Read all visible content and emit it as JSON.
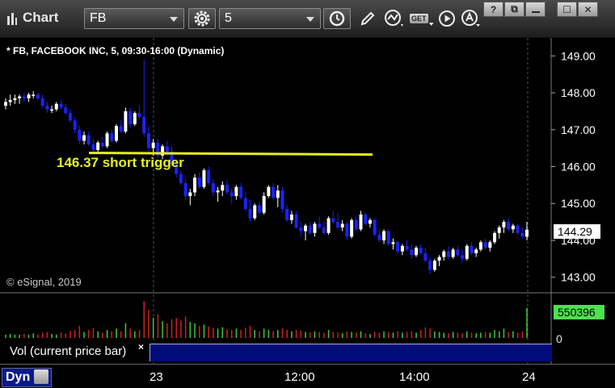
{
  "toolbar": {
    "title": "Chart",
    "symbol": "FB",
    "interval": "5",
    "get_label": "GET",
    "win_help": "?",
    "win_restore": "⧉",
    "win_max": "☐",
    "win_close": "✕"
  },
  "chart_header": "* FB, FACEBOOK INC, 5, 09:30-16:00 (Dynamic)",
  "annotation": "146.37 short trigger",
  "copyright": "© eSignal, 2019",
  "price_tag": "144.29",
  "volume_tag": "550396",
  "volume_zero": "0",
  "volume_label": "Vol (current price bar)",
  "volume_close": "×",
  "dyn_label": "Dyn",
  "x_ticks": [
    "23",
    "12:00",
    "14:00",
    "24"
  ],
  "colors": {
    "up": "#ffffff",
    "down": "#1a22ff",
    "trigger": "#e6f020",
    "vol_up": "#3cc83c",
    "vol_down": "#d02020"
  },
  "chart_data": [
    {
      "type": "candlestick",
      "title": "* FB, FACEBOOK INC, 5, 09:30-16:00 (Dynamic)",
      "ylim": [
        142.6,
        149.4
      ],
      "y_ticks": [
        149.0,
        148.0,
        147.0,
        146.0,
        145.0,
        144.0,
        143.0
      ],
      "grid": false,
      "horizontal_line": {
        "value": 146.37,
        "label": "146.37 short trigger"
      },
      "last_price": 144.29,
      "series": [
        {
          "values": [
            [
              147.65,
              147.85,
              147.55,
              147.75
            ],
            [
              147.75,
              147.95,
              147.65,
              147.8
            ],
            [
              147.8,
              147.95,
              147.7,
              147.85
            ],
            [
              147.85,
              147.95,
              147.7,
              147.9
            ],
            [
              147.9,
              148.0,
              147.75,
              147.85
            ],
            [
              147.85,
              148.0,
              147.75,
              147.95
            ],
            [
              147.95,
              148.05,
              147.85,
              147.95
            ],
            [
              147.95,
              148.0,
              147.8,
              147.85
            ],
            [
              147.85,
              147.95,
              147.6,
              147.65
            ],
            [
              147.65,
              147.75,
              147.45,
              147.55
            ],
            [
              147.55,
              147.65,
              147.45,
              147.55
            ],
            [
              147.55,
              147.75,
              147.5,
              147.7
            ],
            [
              147.7,
              147.8,
              147.55,
              147.6
            ],
            [
              147.6,
              147.7,
              147.4,
              147.45
            ],
            [
              147.45,
              147.55,
              147.2,
              147.25
            ],
            [
              147.25,
              147.35,
              146.9,
              147.0
            ],
            [
              147.0,
              147.1,
              146.6,
              146.7
            ],
            [
              146.7,
              146.95,
              146.6,
              146.85
            ],
            [
              146.85,
              146.95,
              146.55,
              146.6
            ],
            [
              146.6,
              146.75,
              146.35,
              146.45
            ],
            [
              146.45,
              146.7,
              146.4,
              146.65
            ],
            [
              146.65,
              146.8,
              146.5,
              146.55
            ],
            [
              146.55,
              146.95,
              146.5,
              146.9
            ],
            [
              146.9,
              147.0,
              146.65,
              146.7
            ],
            [
              146.7,
              147.15,
              146.65,
              147.1
            ],
            [
              147.1,
              147.25,
              146.9,
              146.95
            ],
            [
              146.95,
              147.6,
              146.9,
              147.5
            ],
            [
              147.5,
              147.6,
              147.05,
              147.15
            ],
            [
              147.15,
              147.5,
              147.1,
              147.45
            ],
            [
              147.45,
              147.65,
              147.3,
              147.35
            ],
            [
              147.35,
              148.9,
              146.8,
              146.9
            ],
            [
              146.9,
              147.1,
              146.4,
              146.5
            ],
            [
              146.5,
              146.75,
              146.3,
              146.65
            ],
            [
              146.65,
              146.75,
              146.25,
              146.3
            ],
            [
              146.3,
              146.6,
              146.2,
              146.55
            ],
            [
              146.55,
              146.7,
              146.3,
              146.4
            ],
            [
              146.4,
              146.55,
              146.0,
              146.05
            ],
            [
              146.05,
              146.2,
              145.7,
              145.8
            ],
            [
              145.8,
              145.9,
              145.5,
              145.55
            ],
            [
              145.55,
              145.7,
              145.1,
              145.2
            ],
            [
              145.2,
              145.4,
              144.95,
              145.3
            ],
            [
              145.3,
              145.8,
              145.2,
              145.7
            ],
            [
              145.7,
              145.85,
              145.4,
              145.45
            ],
            [
              145.45,
              145.95,
              145.4,
              145.9
            ],
            [
              145.9,
              146.0,
              145.5,
              145.55
            ],
            [
              145.55,
              145.65,
              145.2,
              145.3
            ],
            [
              145.3,
              145.45,
              145.05,
              145.35
            ],
            [
              145.35,
              145.6,
              145.2,
              145.5
            ],
            [
              145.5,
              145.65,
              145.25,
              145.3
            ],
            [
              145.3,
              145.4,
              145.0,
              145.2
            ],
            [
              145.2,
              145.5,
              145.1,
              145.45
            ],
            [
              145.45,
              145.55,
              145.1,
              145.15
            ],
            [
              145.15,
              145.3,
              144.8,
              144.85
            ],
            [
              144.85,
              145.1,
              144.5,
              144.6
            ],
            [
              144.6,
              145.0,
              144.55,
              144.95
            ],
            [
              144.95,
              145.05,
              144.7,
              144.75
            ],
            [
              144.75,
              145.3,
              144.7,
              145.2
            ],
            [
              145.2,
              145.5,
              145.15,
              145.45
            ],
            [
              145.45,
              145.55,
              145.1,
              145.15
            ],
            [
              145.15,
              145.5,
              144.9,
              145.35
            ],
            [
              145.35,
              145.45,
              144.75,
              144.85
            ],
            [
              144.85,
              144.95,
              144.5,
              144.55
            ],
            [
              144.55,
              144.8,
              144.45,
              144.7
            ],
            [
              144.7,
              144.8,
              144.3,
              144.35
            ],
            [
              144.35,
              144.5,
              144.1,
              144.25
            ],
            [
              144.25,
              144.45,
              144.0,
              144.4
            ],
            [
              144.4,
              144.5,
              144.15,
              144.2
            ],
            [
              144.2,
              144.5,
              144.1,
              144.45
            ],
            [
              144.45,
              144.65,
              144.3,
              144.35
            ],
            [
              144.35,
              144.5,
              144.15,
              144.2
            ],
            [
              144.2,
              144.65,
              144.15,
              144.6
            ],
            [
              144.6,
              144.8,
              144.45,
              144.5
            ],
            [
              144.5,
              144.75,
              144.3,
              144.35
            ],
            [
              144.35,
              144.55,
              144.25,
              144.45
            ],
            [
              144.45,
              144.5,
              144.0,
              144.1
            ],
            [
              144.1,
              144.6,
              144.05,
              144.55
            ],
            [
              144.55,
              144.65,
              144.25,
              144.3
            ],
            [
              144.3,
              144.8,
              144.25,
              144.7
            ],
            [
              144.7,
              144.75,
              144.4,
              144.45
            ],
            [
              144.45,
              144.6,
              144.35,
              144.55
            ],
            [
              144.55,
              144.6,
              144.1,
              144.15
            ],
            [
              144.15,
              144.3,
              143.95,
              144.0
            ],
            [
              144.0,
              144.3,
              143.9,
              144.25
            ],
            [
              144.25,
              144.3,
              143.85,
              143.9
            ],
            [
              143.9,
              144.05,
              143.75,
              143.95
            ],
            [
              143.95,
              144.0,
              143.6,
              143.7
            ],
            [
              143.7,
              143.9,
              143.6,
              143.85
            ],
            [
              143.85,
              144.0,
              143.7,
              143.75
            ],
            [
              143.75,
              143.9,
              143.5,
              143.6
            ],
            [
              143.6,
              143.85,
              143.55,
              143.8
            ],
            [
              143.8,
              143.9,
              143.6,
              143.65
            ],
            [
              143.65,
              143.8,
              143.4,
              143.45
            ],
            [
              143.45,
              143.55,
              143.1,
              143.2
            ],
            [
              143.2,
              143.5,
              143.15,
              143.45
            ],
            [
              143.45,
              143.6,
              143.3,
              143.55
            ],
            [
              143.55,
              143.75,
              143.45,
              143.7
            ],
            [
              143.7,
              143.85,
              143.5,
              143.55
            ],
            [
              143.55,
              143.8,
              143.5,
              143.75
            ],
            [
              143.75,
              143.85,
              143.55,
              143.6
            ],
            [
              143.6,
              143.75,
              143.4,
              143.5
            ],
            [
              143.5,
              143.9,
              143.45,
              143.85
            ],
            [
              143.85,
              143.95,
              143.6,
              143.65
            ],
            [
              143.65,
              143.8,
              143.55,
              143.75
            ],
            [
              143.75,
              144.0,
              143.7,
              143.95
            ],
            [
              143.95,
              144.05,
              143.75,
              143.8
            ],
            [
              143.8,
              144.0,
              143.7,
              143.95
            ],
            [
              143.95,
              144.25,
              143.9,
              144.2
            ],
            [
              144.2,
              144.4,
              144.05,
              144.35
            ],
            [
              144.35,
              144.55,
              144.2,
              144.5
            ],
            [
              144.5,
              144.6,
              144.25,
              144.3
            ],
            [
              144.3,
              144.45,
              144.2,
              144.4
            ],
            [
              144.4,
              144.45,
              144.15,
              144.2
            ],
            [
              144.2,
              144.35,
              144.05,
              144.1
            ],
            [
              144.1,
              144.5,
              144.0,
              144.29
            ]
          ]
        }
      ]
    },
    {
      "type": "bar",
      "title": "Vol (current price bar)",
      "last_value": 550396,
      "series": [
        {
          "values": [
            0.05,
            0.06,
            0.05,
            0.05,
            0.06,
            0.05,
            0.07,
            0.05,
            0.08,
            0.09,
            0.06,
            0.05,
            0.08,
            0.07,
            0.1,
            0.12,
            0.18,
            0.09,
            0.12,
            0.15,
            0.1,
            0.08,
            0.12,
            0.1,
            0.14,
            0.1,
            0.22,
            0.14,
            0.1,
            0.12,
            0.55,
            0.42,
            0.3,
            0.35,
            0.25,
            0.22,
            0.28,
            0.3,
            0.26,
            0.32,
            0.24,
            0.22,
            0.18,
            0.2,
            0.17,
            0.15,
            0.14,
            0.16,
            0.13,
            0.12,
            0.14,
            0.12,
            0.15,
            0.18,
            0.12,
            0.1,
            0.14,
            0.12,
            0.1,
            0.12,
            0.14,
            0.12,
            0.1,
            0.12,
            0.11,
            0.09,
            0.08,
            0.1,
            0.09,
            0.08,
            0.12,
            0.09,
            0.08,
            0.07,
            0.1,
            0.09,
            0.08,
            0.1,
            0.07,
            0.06,
            0.09,
            0.08,
            0.1,
            0.09,
            0.08,
            0.1,
            0.08,
            0.09,
            0.1,
            0.08,
            0.12,
            0.16,
            0.14,
            0.1,
            0.09,
            0.08,
            0.07,
            0.09,
            0.08,
            0.07,
            0.1,
            0.08,
            0.07,
            0.08,
            0.09,
            0.08,
            0.12,
            0.1,
            0.14,
            0.09,
            0.1,
            0.08,
            0.1,
            0.45
          ]
        }
      ]
    }
  ]
}
